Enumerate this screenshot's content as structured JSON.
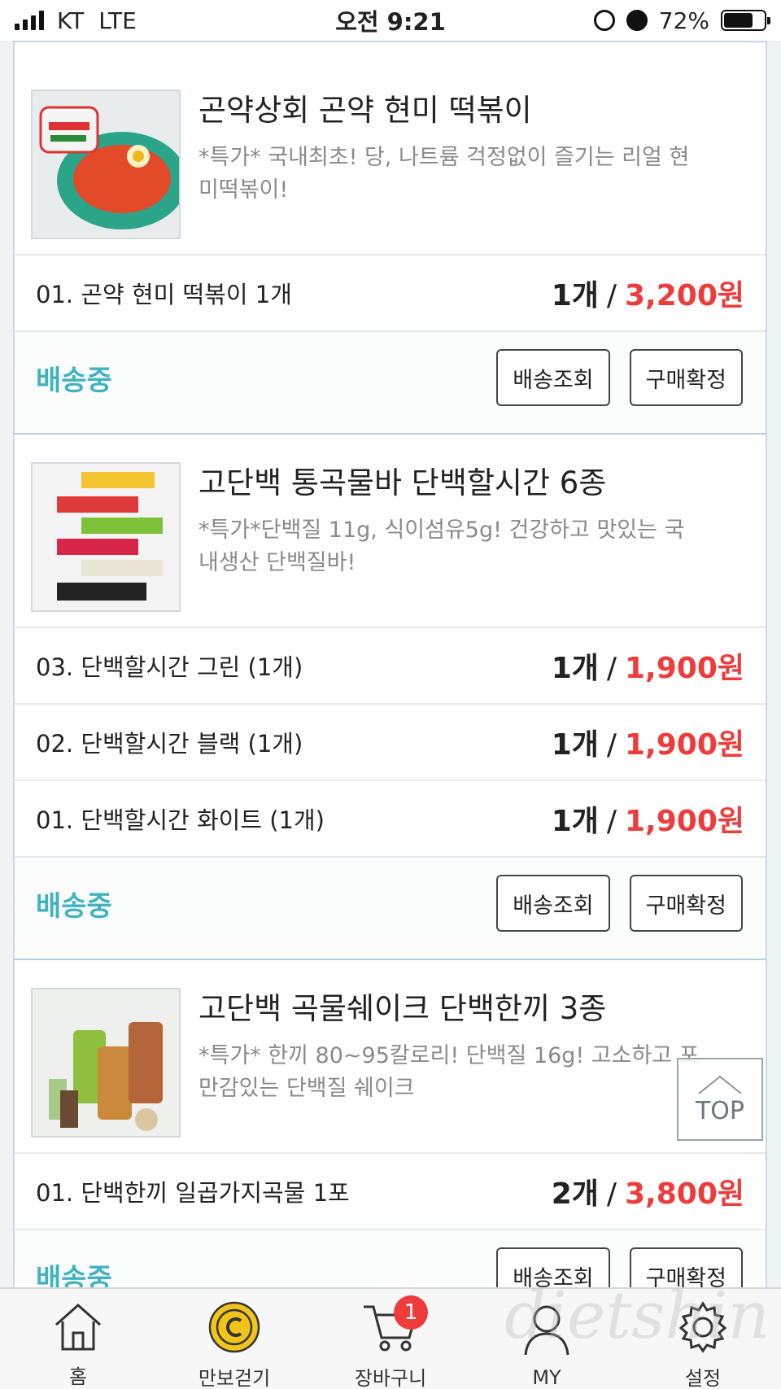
{
  "status_bar": {
    "carrier": "KT",
    "network": "LTE",
    "time": "오전 9:21",
    "battery": "72%",
    "battery_level": 0.72
  },
  "orders": [
    {
      "title": "곤약상회 곤약 현미 떡볶이",
      "description": "*특가* 국내최초! 당, 나트륨 걱정없이 즐기는 리얼 현미떡볶이!",
      "options": [
        {
          "name": "01. 곤약 현미 떡볶이 1개",
          "qty": "1개",
          "price": "3,200원"
        }
      ],
      "status": "배송중",
      "track_label": "배송조회",
      "confirm_label": "구매확정"
    },
    {
      "title": "고단백 통곡물바 단백할시간 6종",
      "description": "*특가*단백질 11g, 식이섬유5g! 건강하고 맛있는 국내생산 단백질바!",
      "options": [
        {
          "name": "03. 단백할시간 그린 (1개)",
          "qty": "1개",
          "price": "1,900원"
        },
        {
          "name": "02. 단백할시간 블랙 (1개)",
          "qty": "1개",
          "price": "1,900원"
        },
        {
          "name": "01. 단백할시간 화이트 (1개)",
          "qty": "1개",
          "price": "1,900원"
        }
      ],
      "status": "배송중",
      "track_label": "배송조회",
      "confirm_label": "구매확정"
    },
    {
      "title": "고단백 곡물쉐이크 단백한끼 3종",
      "description": "*특가* 한끼 80~95칼로리! 단백질 16g! 고소하고 포만감있는 단백질 쉐이크",
      "options": [
        {
          "name": "01. 단백한끼 일곱가지곡물 1포",
          "qty": "2개",
          "price": "3,800원"
        }
      ],
      "status": "배송중",
      "track_label": "배송조회",
      "confirm_label": "구매확정"
    }
  ],
  "top_button": "TOP",
  "nav": {
    "home": "홈",
    "walk": "만보걷기",
    "cart": "장바구니",
    "cart_badge": "1",
    "my": "MY",
    "settings": "설정"
  },
  "watermark": "dietshin",
  "colors": {
    "accent": "#41b3bf",
    "price": "#ee3b3b",
    "badge": "#ee3b3b",
    "coin": "#f0c419"
  }
}
